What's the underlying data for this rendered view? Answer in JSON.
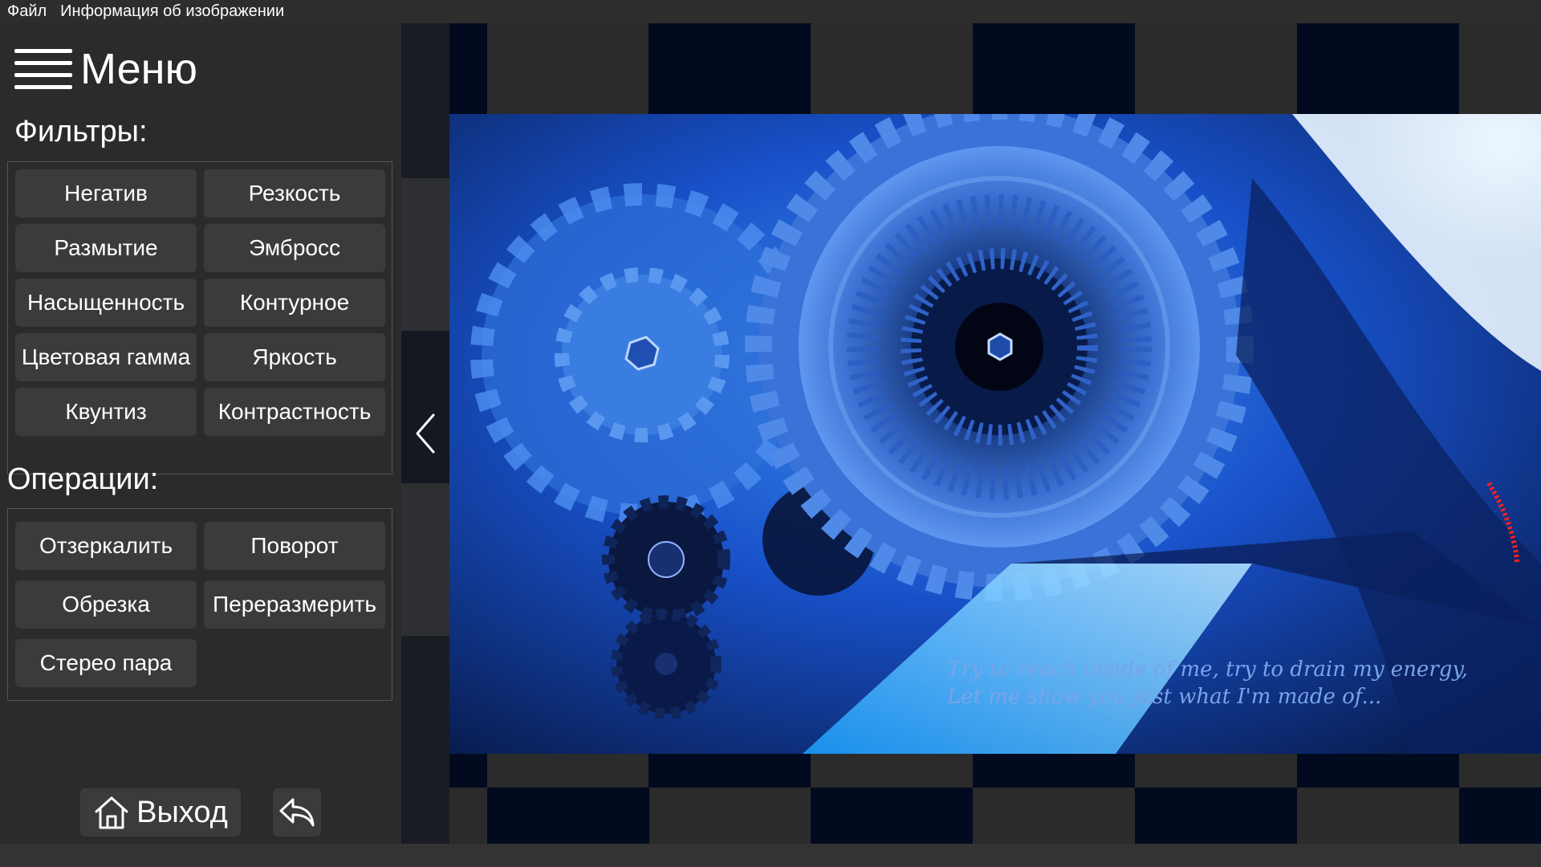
{
  "menubar": {
    "items": [
      "Файл",
      "Информация об изображении"
    ]
  },
  "sidebar": {
    "menu_title": "Меню",
    "filters_title": "Фильтры:",
    "filters": [
      "Негатив",
      "Резкость",
      "Размытие",
      "Эмбросс",
      "Насыщенность",
      "Контурное",
      "Цветовая гамма",
      "Яркость",
      "Квунтиз",
      "Контрастность"
    ],
    "operations_title": "Операции:",
    "operations": [
      "Отзеркалить",
      "Поворот",
      "Обрезка",
      "Переразмерить",
      "Стерео пара"
    ],
    "exit_label": "Выход"
  },
  "image": {
    "caption_line1": "Try to reach inside of me, try to drain my energy,",
    "caption_line2": "Let me show you just what I'm made of..."
  },
  "colors": {
    "background": "#2b2b2b",
    "button": "#3b3b3b",
    "checker_dark": "#010a1e",
    "accent_blue": "#1e6bff"
  },
  "icons": [
    "hamburger-icon",
    "home-icon",
    "undo-arrow-icon",
    "chevron-left-icon"
  ]
}
